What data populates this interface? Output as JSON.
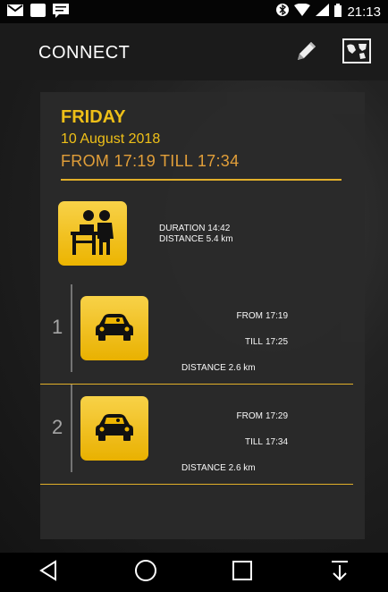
{
  "status_bar": {
    "time": "21:13"
  },
  "app_bar": {
    "title": "CONNECT"
  },
  "card": {
    "day": "FRIDAY",
    "date": "10 August 2018",
    "range": "FROM 17:19 TILL 17:34",
    "summary": {
      "duration": "DURATION 14:42",
      "distance": "DISTANCE  5.4 km"
    },
    "trips": [
      {
        "number": "1",
        "from_label": "FROM",
        "from": "17:19",
        "till_label": "TILL",
        "till": "17:25",
        "distance": "DISTANCE  2.6 km"
      },
      {
        "number": "2",
        "from_label": "FROM",
        "from": "17:29",
        "till_label": "TILL",
        "till": "17:34",
        "distance": "DISTANCE  2.6 km"
      }
    ]
  },
  "colors": {
    "accent": "#f5c518",
    "accent_orange": "#e8a33a",
    "icon_bg": "#f3b900"
  },
  "icons": [
    "gmail-icon",
    "app-icon",
    "message-icon",
    "bluetooth-icon",
    "wifi-icon",
    "signal-icon",
    "battery-icon",
    "pencil-icon",
    "map-icon",
    "reception-icon",
    "car-icon",
    "back-icon",
    "home-icon",
    "recents-icon",
    "download-icon"
  ]
}
